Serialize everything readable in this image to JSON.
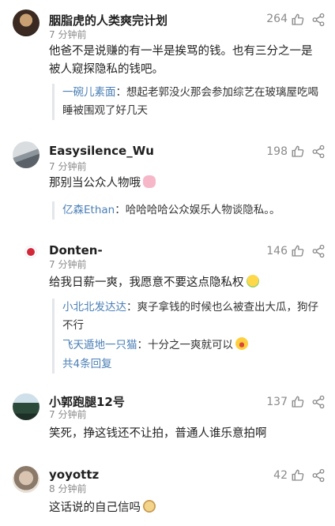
{
  "comments": [
    {
      "username": "胭脂虎的人类爽完计划",
      "time": "7 分钟前",
      "likes": "264",
      "content": "他爸不是说赚的有一半是挨骂的钱。也有三分之一是被人窥探隐私的钱吧。",
      "replies": [
        {
          "user": "一碗儿素面",
          "text": "：想起老郭没火那会参加综艺在玻璃屋吃喝睡被围观了好几天"
        }
      ]
    },
    {
      "username": "Easysilence_Wu",
      "time": "7 分钟前",
      "likes": "198",
      "content": "那别当公众人物哦",
      "replies": [
        {
          "user": "亿森Ethan",
          "text": "：哈哈哈哈公众娱乐人物谈隐私。。"
        }
      ]
    },
    {
      "username": "Donten-",
      "time": "7 分钟前",
      "likes": "146",
      "content": "给我日薪一爽，我愿意不要这点隐私权",
      "replies": [
        {
          "user": "小北北发达达",
          "text": "：爽子拿钱的时候也么被查出大瓜，狗仔不行"
        },
        {
          "user": "飞天遁地一只猫",
          "text": "：十分之一爽就可以"
        }
      ],
      "more": "共4条回复"
    },
    {
      "username": "小郭跑腿12号",
      "time": "7 分钟前",
      "likes": "137",
      "content": "笑死，挣这钱还不让拍，普通人谁乐意拍啊",
      "replies": []
    },
    {
      "username": "yoyottz",
      "time": "8 分钟前",
      "likes": "42",
      "content": "这话说的自己信吗",
      "replies": []
    }
  ],
  "icons": {
    "like": "thumbs-up-icon",
    "share": "share-icon"
  },
  "colors": {
    "reply_user": "#4a7fb5",
    "meta": "#8a8a8a"
  }
}
